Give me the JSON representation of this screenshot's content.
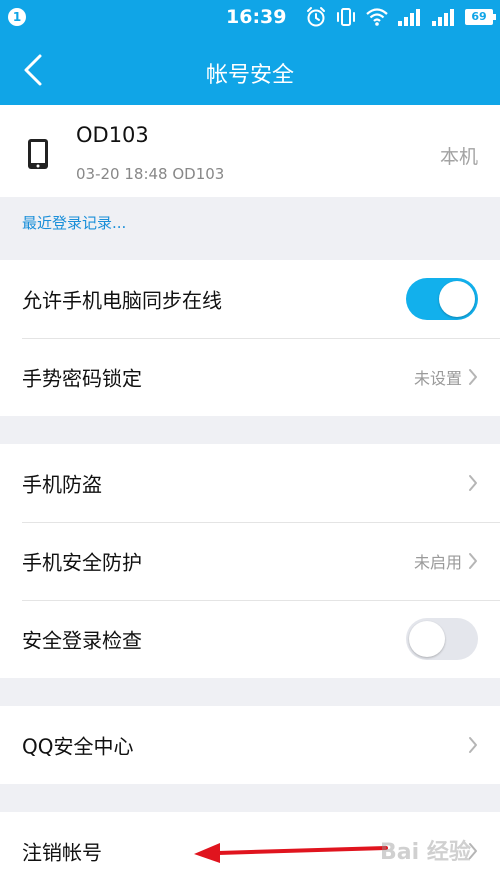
{
  "status_bar": {
    "notification_count": "1",
    "time": "16:39",
    "battery": "69",
    "icons": [
      "alarm-icon",
      "vibrate-icon",
      "wifi-icon",
      "signal-icon",
      "signal-icon",
      "battery-icon"
    ]
  },
  "header": {
    "title": "帐号安全",
    "back_icon": "chevron-left-icon"
  },
  "device": {
    "icon": "phone-icon",
    "name": "OD103",
    "last_login": "03-20 18:48 OD103",
    "tag": "本机"
  },
  "recent_login_link": "最近登录记录...",
  "groups": [
    {
      "rows": [
        {
          "label": "允许手机电脑同步在线",
          "control": "toggle",
          "toggle_state": "on"
        },
        {
          "label": "手势密码锁定",
          "value": "未设置",
          "control": "chevron"
        }
      ]
    },
    {
      "rows": [
        {
          "label": "手机防盗",
          "value": "",
          "control": "chevron"
        },
        {
          "label": "手机安全防护",
          "value": "未启用",
          "control": "chevron"
        },
        {
          "label": "安全登录检查",
          "control": "toggle",
          "toggle_state": "off"
        }
      ]
    },
    {
      "rows": [
        {
          "label": "QQ安全中心",
          "value": "",
          "control": "chevron"
        }
      ]
    },
    {
      "rows": [
        {
          "label": "注销帐号",
          "value": "",
          "control": "chevron"
        }
      ]
    }
  ],
  "annotation": {
    "arrow_color": "#e0141e"
  },
  "watermark": "Bai 经验",
  "colors": {
    "header": "#10a5e7",
    "toggle_on": "#12b0ec",
    "toggle_off": "#e4e6ec",
    "link": "#1a8fd9",
    "background": "#eff0f4"
  }
}
